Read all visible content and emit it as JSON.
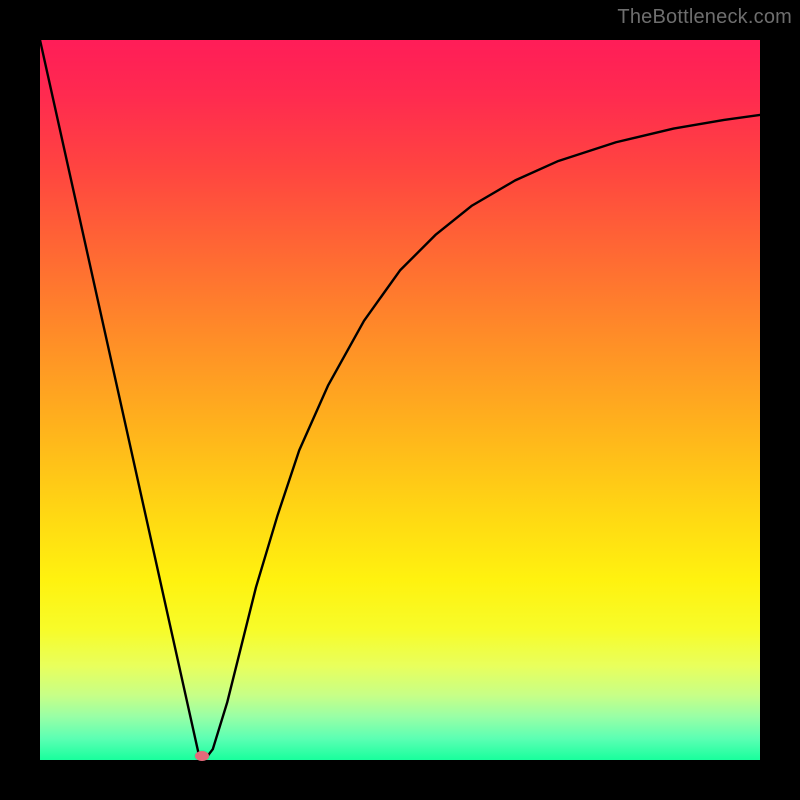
{
  "watermark": "TheBottleneck.com",
  "chart_data": {
    "type": "line",
    "title": "",
    "xlabel": "",
    "ylabel": "",
    "xlim": [
      0,
      100
    ],
    "ylim": [
      0,
      100
    ],
    "grid": false,
    "legend": false,
    "background_gradient": {
      "orientation": "vertical",
      "stops": [
        {
          "pos": 0,
          "color": "#ff1d58"
        },
        {
          "pos": 18,
          "color": "#ff4540"
        },
        {
          "pos": 42,
          "color": "#ff8f27"
        },
        {
          "pos": 66,
          "color": "#ffd813"
        },
        {
          "pos": 82,
          "color": "#e8ff5d"
        },
        {
          "pos": 94,
          "color": "#98ffa6"
        },
        {
          "pos": 100,
          "color": "#18ff9d"
        }
      ]
    },
    "series": [
      {
        "name": "bottleneck-curve",
        "color": "#000000",
        "x": [
          0,
          2,
          4,
          6,
          8,
          10,
          12,
          14,
          16,
          18,
          20,
          21,
          22,
          23,
          24,
          26,
          28,
          30,
          33,
          36,
          40,
          45,
          50,
          55,
          60,
          66,
          72,
          80,
          88,
          95,
          100
        ],
        "y": [
          100,
          91,
          82,
          73,
          64,
          55,
          46,
          37,
          28,
          19,
          10,
          5.5,
          1.0,
          0.2,
          1.5,
          8,
          16,
          24,
          34,
          43,
          52,
          61,
          68,
          73,
          77,
          80.5,
          83.2,
          85.8,
          87.7,
          88.9,
          89.6
        ]
      }
    ],
    "markers": [
      {
        "name": "optimal-point",
        "x": 22.5,
        "y": 0.5,
        "color": "#e46a7a"
      }
    ]
  }
}
